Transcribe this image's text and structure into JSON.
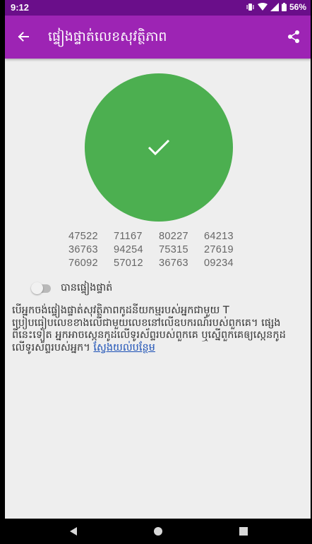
{
  "status_bar": {
    "time": "9:12",
    "battery": "56%",
    "icons": [
      "vibrate-icon",
      "wifi-icon",
      "signal-icon",
      "battery-icon"
    ]
  },
  "app_bar": {
    "title": "ផ្ទៀងផ្ទាត់លេខសុវត្ថិភាព",
    "back_icon": "arrow-left",
    "share_icon": "share",
    "color": "#9d24b4"
  },
  "verify_badge": {
    "icon": "check",
    "color": "#4caf50"
  },
  "safety_number": {
    "rows": [
      [
        "47522",
        "71167",
        "80227",
        "64213"
      ],
      [
        "36763",
        "94254",
        "75315",
        "27619"
      ],
      [
        "76092",
        "57012",
        "36763",
        "09234"
      ]
    ]
  },
  "verified_toggle": {
    "label": "បានផ្ទៀងផ្ទាត់",
    "checked": false
  },
  "info": {
    "lines": [
      "បើអ្នកចង់ផ្ទៀងផ្ទាត់សុវត្ថិភាពកូដនីយកម្មរបស់អ្នកជាមួយ T",
      "ប្រៀបធៀបលេខខាងលើជាមួយលេខនៅលើឧបករណ៍របស់ពួកគេ។ ផ្សេង",
      "ពីនេះទៀត អ្នកអាចស្កេនកូដលើទូរស័ព្ទរបស់ពួកគេ ឬស្នើពួកគេឲ្យស្កេនកូដ",
      "លើទូរស័ព្ទរបស់អ្នក។"
    ],
    "link_text": "ស្វែងយល់បន្ថែម"
  },
  "nav_bar": {
    "buttons": [
      "back-triangle",
      "home-circle",
      "recents-square"
    ]
  }
}
